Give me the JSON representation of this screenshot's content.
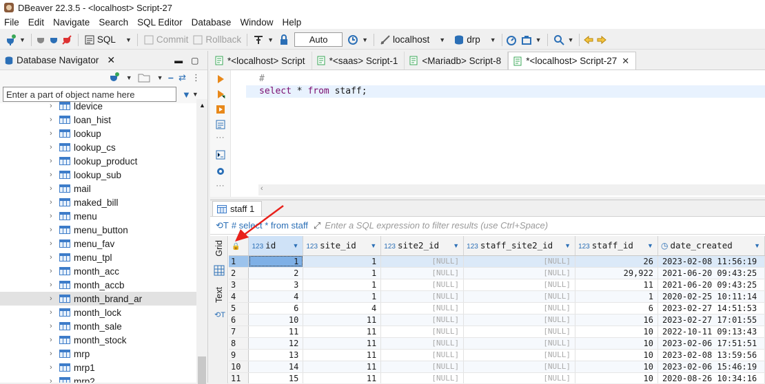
{
  "window": {
    "title": "DBeaver 22.3.5 - <localhost> Script-27"
  },
  "menu": [
    "File",
    "Edit",
    "Navigate",
    "Search",
    "SQL Editor",
    "Database",
    "Window",
    "Help"
  ],
  "toolbar": {
    "sql_label": "SQL",
    "commit_label": "Commit",
    "rollback_label": "Rollback",
    "auto_label": "Auto",
    "connection_label": "localhost",
    "database_label": "drp"
  },
  "navigator": {
    "title": "Database Navigator",
    "filter_placeholder": "Enter a part of object name here",
    "items": [
      {
        "label": "ldevice"
      },
      {
        "label": "loan_hist"
      },
      {
        "label": "lookup"
      },
      {
        "label": "lookup_cs"
      },
      {
        "label": "lookup_product"
      },
      {
        "label": "lookup_sub"
      },
      {
        "label": "mail"
      },
      {
        "label": "maked_bill"
      },
      {
        "label": "menu"
      },
      {
        "label": "menu_button"
      },
      {
        "label": "menu_fav"
      },
      {
        "label": "menu_tpl"
      },
      {
        "label": "month_acc"
      },
      {
        "label": "month_accb"
      },
      {
        "label": "month_brand_ar"
      },
      {
        "label": "month_lock"
      },
      {
        "label": "month_sale"
      },
      {
        "label": "month_stock"
      },
      {
        "label": "mrp"
      },
      {
        "label": "mrp1"
      },
      {
        "label": "mrp2"
      }
    ],
    "selected_index": 14
  },
  "editor": {
    "tabs": [
      {
        "label": "*<localhost> Script",
        "active": false
      },
      {
        "label": "*<saas> Script-1",
        "active": false
      },
      {
        "label": "<Mariadb> Script-8",
        "active": false
      },
      {
        "label": "*<localhost> Script-27",
        "active": true
      }
    ],
    "lines": [
      "#",
      "select * from staff;"
    ]
  },
  "results": {
    "tab_label": "staff 1",
    "filter_label": "# select * from staff",
    "filter_hint": "Enter a SQL expression to filter results (use Ctrl+Space)",
    "side_grid": "Grid",
    "side_text": "Text",
    "type_badge": "123",
    "null_text": "[NULL]",
    "columns": [
      "id",
      "site_id",
      "site2_id",
      "staff_site2_id",
      "staff_id",
      "date_created"
    ],
    "rows": [
      [
        "1",
        "1",
        "1",
        "[NULL]",
        "[NULL]",
        "26",
        "2023-02-08 11:56:19"
      ],
      [
        "2",
        "2",
        "1",
        "[NULL]",
        "[NULL]",
        "29,922",
        "2021-06-20 09:43:25"
      ],
      [
        "3",
        "3",
        "1",
        "[NULL]",
        "[NULL]",
        "11",
        "2021-06-20 09:43:25"
      ],
      [
        "4",
        "4",
        "1",
        "[NULL]",
        "[NULL]",
        "1",
        "2020-02-25 10:11:14"
      ],
      [
        "5",
        "6",
        "4",
        "[NULL]",
        "[NULL]",
        "6",
        "2023-02-27 14:51:53"
      ],
      [
        "6",
        "10",
        "11",
        "[NULL]",
        "[NULL]",
        "16",
        "2023-02-27 17:01:55"
      ],
      [
        "7",
        "11",
        "11",
        "[NULL]",
        "[NULL]",
        "10",
        "2022-10-11 09:13:43"
      ],
      [
        "8",
        "12",
        "11",
        "[NULL]",
        "[NULL]",
        "10",
        "2023-02-06 17:51:51"
      ],
      [
        "9",
        "13",
        "11",
        "[NULL]",
        "[NULL]",
        "10",
        "2023-02-08 13:59:56"
      ],
      [
        "10",
        "14",
        "11",
        "[NULL]",
        "[NULL]",
        "10",
        "2023-02-06 15:46:19"
      ],
      [
        "11",
        "15",
        "11",
        "[NULL]",
        "[NULL]",
        "10",
        "2020-08-26 10:34:16"
      ]
    ]
  },
  "colors": {
    "accent": "#2b6fb6",
    "selected_row": "#dbe9f8",
    "arrow": "#e8211b"
  }
}
